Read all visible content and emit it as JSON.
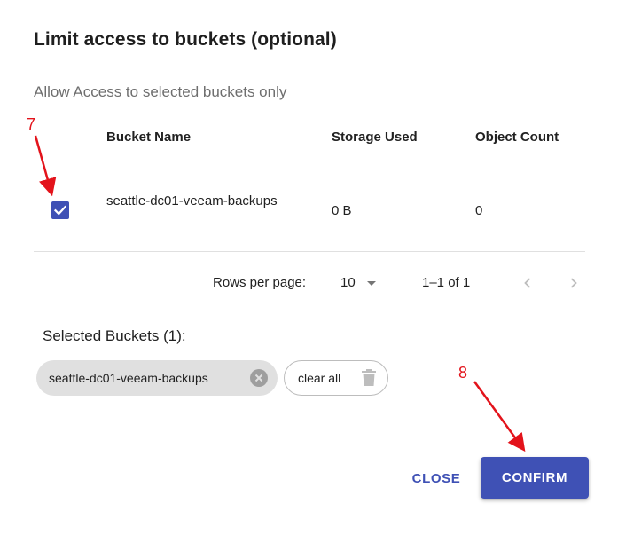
{
  "dialog": {
    "title": "Limit access to buckets (optional)",
    "subtitle": "Allow Access to selected buckets only"
  },
  "table": {
    "headers": {
      "name": "Bucket Name",
      "storage": "Storage Used",
      "count": "Object Count"
    },
    "rows": [
      {
        "name": "seattle-dc01-veeam-backups",
        "storage": "0 B",
        "count": "0",
        "checked": true
      }
    ]
  },
  "pagination": {
    "rows_per_page_label": "Rows per page:",
    "rows_per_page_value": "10",
    "range_text": "1–1 of 1"
  },
  "selected": {
    "label": "Selected Buckets (1):",
    "chips": [
      "seattle-dc01-veeam-backups"
    ],
    "clear_all_label": "clear all"
  },
  "actions": {
    "close_label": "CLOSE",
    "confirm_label": "CONFIRM"
  },
  "annotations": {
    "step_7": "7",
    "step_8": "8"
  },
  "colors": {
    "primary": "#3f51b5",
    "annotation": "#e3131b",
    "chip_bg": "#e0e0e0"
  },
  "icons": [
    "check-icon",
    "caret-down-icon",
    "chevron-left-icon",
    "chevron-right-icon",
    "cancel-circle-icon",
    "trash-icon"
  ]
}
